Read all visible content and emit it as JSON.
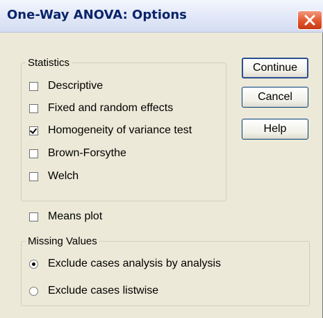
{
  "window": {
    "title": "One-Way ANOVA: Options"
  },
  "statistics": {
    "legend": "Statistics",
    "items": [
      {
        "label": "Descriptive",
        "checked": false
      },
      {
        "label": "Fixed and random effects",
        "checked": false
      },
      {
        "label": "Homogeneity of variance test",
        "checked": true
      },
      {
        "label": "Brown-Forsythe",
        "checked": false
      },
      {
        "label": "Welch",
        "checked": false
      }
    ]
  },
  "means_plot": {
    "label": "Means plot",
    "checked": false
  },
  "missing_values": {
    "legend": "Missing Values",
    "options": [
      {
        "label": "Exclude cases analysis by analysis",
        "selected": true
      },
      {
        "label": "Exclude cases listwise",
        "selected": false
      }
    ]
  },
  "buttons": {
    "continue": "Continue",
    "cancel": "Cancel",
    "help": "Help"
  },
  "colors": {
    "title_text": "#0a246a",
    "close_button": "#e2562b",
    "dialog_bg": "#ece9d8"
  }
}
